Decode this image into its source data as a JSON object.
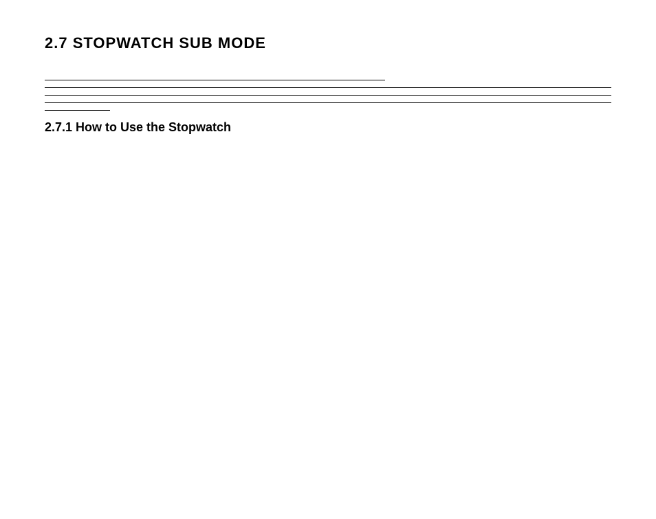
{
  "section": {
    "number": "2.7",
    "title": "STOPWATCH SUB MODE",
    "full_heading": "2.7 STOPWATCH SUB MODE"
  },
  "intro": {
    "p1": "",
    "p2": ""
  },
  "note": {
    "label": "",
    "line1": "",
    "line2": "",
    "line3": ""
  },
  "subsection": {
    "number": "2.7.1",
    "title": "How to Use the Stopwatch",
    "full_heading": "2.7.1 How to Use the Stopwatch"
  },
  "steps": {
    "intro": "",
    "s1": "",
    "s2": "",
    "s3": "",
    "s4": ""
  },
  "page_number": ""
}
